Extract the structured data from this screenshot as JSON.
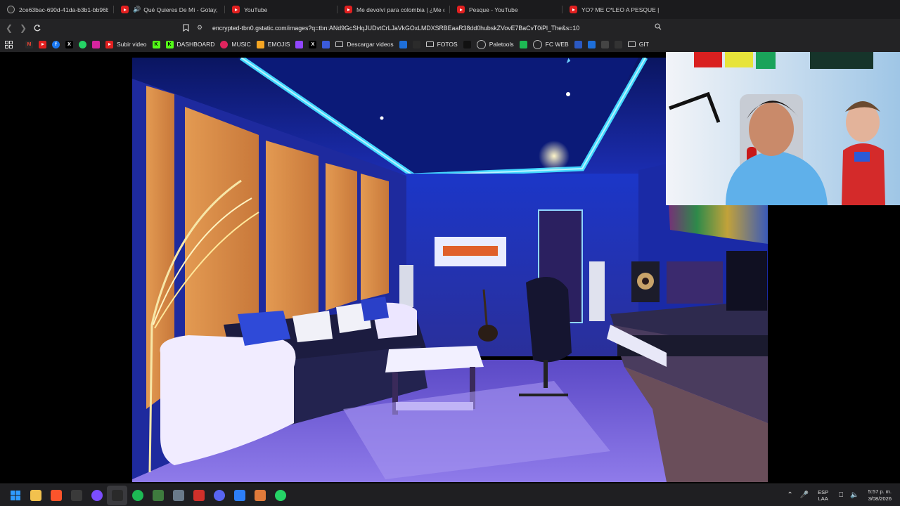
{
  "tabs": [
    {
      "title": "2ce63bac-690d-41da-b3b1-bb96b8",
      "icon": "browser-tab-icon"
    },
    {
      "title": "Qué Quieres De Mí - Gotay, Ñen",
      "icon": "youtube-icon",
      "audio": true
    },
    {
      "title": "YouTube",
      "icon": "youtube-icon"
    },
    {
      "title": "Me devolví para colombia | ¿Me qu",
      "icon": "youtube-icon"
    },
    {
      "title": "Pesque - YouTube",
      "icon": "youtube-icon"
    },
    {
      "title": "YO? ME C*LEO A PESQUE | CHUPIS",
      "icon": "youtube-icon"
    }
  ],
  "address": {
    "url": "encrypted-tbn0.gstatic.com/images?q=tbn:ANd9GcSHqJUDvtCrLJaVkGOxLMDXSRBEaaR38dd0hubskZVovE7BaCvT0iPl_The&s=10"
  },
  "bookmarks": [
    {
      "label": "",
      "icon": "gmail-icon",
      "color": "#2b2b2b"
    },
    {
      "label": "",
      "icon": "youtube-icon",
      "color": "#e12020"
    },
    {
      "label": "",
      "icon": "facebook-icon",
      "color": "#1877f2"
    },
    {
      "label": "",
      "icon": "x-icon",
      "color": "#000000"
    },
    {
      "label": "",
      "icon": "whatsapp-icon",
      "color": "#25d366"
    },
    {
      "label": "",
      "icon": "instagram-icon",
      "color": "#d6249f"
    },
    {
      "label": "Subir video",
      "icon": "youtube-icon",
      "color": "#e12020"
    },
    {
      "label": "",
      "icon": "kick-icon",
      "color": "#53fc18"
    },
    {
      "label": "DASHBOARD",
      "icon": "kick-icon",
      "color": "#53fc18"
    },
    {
      "label": "MUSIC",
      "icon": "music-icon",
      "color": "#e0245e"
    },
    {
      "label": "EMOJIS",
      "icon": "emoji-icon",
      "color": "#f5a623"
    },
    {
      "label": "",
      "icon": "twitch-icon",
      "color": "#9146ff"
    },
    {
      "label": "",
      "icon": "x-icon",
      "color": "#000000"
    },
    {
      "label": "",
      "icon": "loading-icon",
      "color": "#3b5bdb"
    },
    {
      "label": "Descargar videos",
      "icon": "folder-icon",
      "color": ""
    },
    {
      "label": "",
      "icon": "app-icon",
      "color": "#1e6fd9"
    },
    {
      "label": "",
      "icon": "diamond-icon",
      "color": "#2b2b2b"
    },
    {
      "label": "FOTOS",
      "icon": "folder-icon",
      "color": ""
    },
    {
      "label": "",
      "icon": "tiktok-icon",
      "color": "#111111"
    },
    {
      "label": "Paletools",
      "icon": "globe-icon",
      "color": "#555555"
    },
    {
      "label": "",
      "icon": "futbin-icon",
      "color": "#1db954"
    },
    {
      "label": "FC WEB",
      "icon": "globe-icon",
      "color": "#555555"
    },
    {
      "label": "",
      "icon": "app-icon",
      "color": "#2b59c3"
    },
    {
      "label": "",
      "icon": "play-icon",
      "color": "#1e6fd9"
    },
    {
      "label": "",
      "icon": "grid-icon",
      "color": "#444444"
    },
    {
      "label": "",
      "icon": "text-icon",
      "color": "#333333"
    },
    {
      "label": "GIT",
      "icon": "folder-icon",
      "color": ""
    }
  ],
  "taskbar": {
    "apps": [
      {
        "icon": "windows-start-icon",
        "color": "#2f9bff"
      },
      {
        "icon": "file-explorer-icon",
        "color": "#f2c14e"
      },
      {
        "icon": "brave-browser-icon",
        "color": "#fb542b"
      },
      {
        "icon": "steam-icon",
        "color": "#3a3a3a"
      },
      {
        "icon": "app-icon",
        "color": "#7b4dff"
      },
      {
        "icon": "epic-games-icon",
        "color": "#2a2a2a"
      },
      {
        "icon": "spotify-icon",
        "color": "#1db954"
      },
      {
        "icon": "app-icon",
        "color": "#3e7b3e"
      },
      {
        "icon": "settings-icon",
        "color": "#6a7a8a"
      },
      {
        "icon": "app-icon",
        "color": "#d0302a"
      },
      {
        "icon": "discord-icon",
        "color": "#5865f2"
      },
      {
        "icon": "app-icon",
        "color": "#2d7ff9"
      },
      {
        "icon": "app-icon",
        "color": "#e07a3a"
      },
      {
        "icon": "whatsapp-icon",
        "color": "#25d366"
      }
    ],
    "lang_top": "ESP",
    "lang_bottom": "LAA",
    "time": "5:57 p. m.",
    "date": "3/08/2026"
  }
}
